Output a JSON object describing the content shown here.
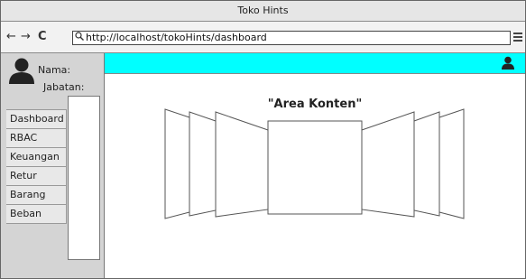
{
  "window": {
    "title": "Toko Hints"
  },
  "browser": {
    "back_glyph": "←",
    "forward_glyph": "→",
    "reload_glyph": "C",
    "url": "http://localhost/tokoHints/dashboard"
  },
  "user": {
    "name_label": "Nama:",
    "position_label": "Jabatan:"
  },
  "sidebar": {
    "items": [
      {
        "label": "Dashboard"
      },
      {
        "label": "RBAC"
      },
      {
        "label": "Keuangan"
      },
      {
        "label": "Retur"
      },
      {
        "label": "Barang"
      },
      {
        "label": "Beban"
      }
    ]
  },
  "content": {
    "title": "\"Area Konten\""
  },
  "colors": {
    "topbar": "#00ffff",
    "sidebar": "#d4d4d4",
    "titlebar": "#e6e6e6"
  },
  "icons": [
    "user-icon",
    "search-icon",
    "hamburger-menu-icon",
    "back-arrow-icon",
    "forward-arrow-icon",
    "reload-icon"
  ]
}
